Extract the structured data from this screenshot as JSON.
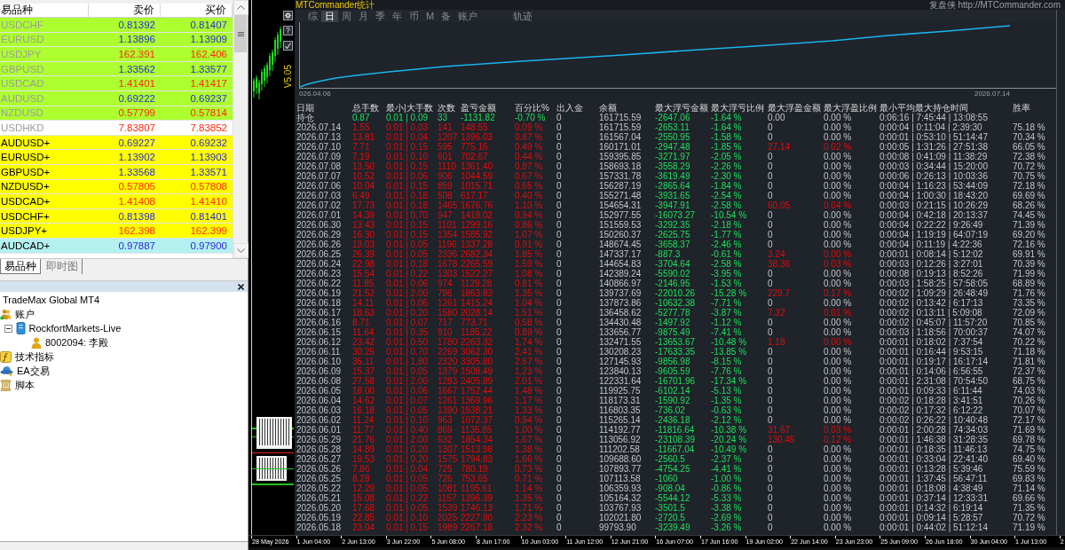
{
  "market_watch": {
    "columns": [
      "易品种",
      "卖价",
      "买价"
    ],
    "quotes": [
      {
        "symbol": "USDCHF",
        "bid": "0.81392",
        "ask": "0.81407",
        "rising": true,
        "color": "#adff2f",
        "greyed": true
      },
      {
        "symbol": "EURUSD",
        "bid": "1.13896",
        "ask": "1.13909",
        "rising": true,
        "color": "#adff2f",
        "greyed": true
      },
      {
        "symbol": "USDJPY",
        "bid": "162.391",
        "ask": "162.406",
        "rising": false,
        "color": "#adff2f",
        "greyed": true
      },
      {
        "symbol": "GBPUSD",
        "bid": "1.33562",
        "ask": "1.33577",
        "rising": true,
        "color": "#adff2f",
        "greyed": true
      },
      {
        "symbol": "USDCAD",
        "bid": "1.41401",
        "ask": "1.41417",
        "rising": false,
        "color": "#adff2f",
        "greyed": true
      },
      {
        "symbol": "AUDUSD",
        "bid": "0.69222",
        "ask": "0.69237",
        "rising": true,
        "color": "#adff2f",
        "greyed": true
      },
      {
        "symbol": "NZDUSD",
        "bid": "0.57799",
        "ask": "0.57814",
        "rising": false,
        "color": "#adff2f",
        "greyed": true
      },
      {
        "symbol": "USDHKD",
        "bid": "7.83807",
        "ask": "7.83852",
        "rising": false,
        "color": "#ffffff",
        "greyed": true
      },
      {
        "symbol": "AUDUSD+",
        "bid": "0.69227",
        "ask": "0.69232",
        "rising": true,
        "color": "#ffff00",
        "greyed": false
      },
      {
        "symbol": "EURUSD+",
        "bid": "1.13902",
        "ask": "1.13903",
        "rising": true,
        "color": "#ffff00",
        "greyed": false
      },
      {
        "symbol": "GBPUSD+",
        "bid": "1.33568",
        "ask": "1.33571",
        "rising": true,
        "color": "#ffff00",
        "greyed": false
      },
      {
        "symbol": "NZDUSD+",
        "bid": "0.57805",
        "ask": "0.57808",
        "rising": false,
        "color": "#ffff00",
        "greyed": false
      },
      {
        "symbol": "USDCAD+",
        "bid": "1.41408",
        "ask": "1.41410",
        "rising": false,
        "color": "#ffff00",
        "greyed": false
      },
      {
        "symbol": "USDCHF+",
        "bid": "0.81398",
        "ask": "0.81401",
        "rising": true,
        "color": "#ffff00",
        "greyed": false
      },
      {
        "symbol": "USDJPY+",
        "bid": "162.398",
        "ask": "162.399",
        "rising": false,
        "color": "#ffff00",
        "greyed": false
      },
      {
        "symbol": "AUDCAD+",
        "bid": "0.97887",
        "ask": "0.97900",
        "rising": true,
        "color": "#b4f0f0",
        "greyed": false
      }
    ]
  },
  "market_watch_tabs": [
    {
      "label": "易品种",
      "selected": true
    },
    {
      "label": "即时图",
      "selected": false
    }
  ],
  "navigator": {
    "tree": [
      {
        "label": "TradeMax Global MT4",
        "children": [
          {
            "label": "账户",
            "kind": "accounts",
            "children": [
              {
                "label": "RockfortMarkets-Live",
                "kind": "server",
                "expanded": true,
                "children": [
                  {
                    "label": "8002094: 李殿",
                    "kind": "account"
                  }
                ]
              }
            ]
          },
          {
            "label": "技术指标",
            "kind": "indicators"
          },
          {
            "label": "EA交易",
            "kind": "experts"
          },
          {
            "label": "脚本",
            "kind": "scripts"
          }
        ]
      }
    ]
  },
  "chart_window": {
    "version": "V5.05"
  },
  "stats_panel": {
    "title": "MTCommander统计",
    "link": "复盘侠 http://MTCommander.com",
    "tabs": [
      {
        "label": "综",
        "selected": false
      },
      {
        "label": "日",
        "selected": true
      },
      {
        "label": "周",
        "selected": false
      },
      {
        "label": "月",
        "selected": false
      },
      {
        "label": "季",
        "selected": false
      },
      {
        "label": "年",
        "selected": false
      },
      {
        "label": "币",
        "selected": false
      },
      {
        "label": "M",
        "selected": false
      },
      {
        "label": "备",
        "selected": false
      },
      {
        "label": "账户",
        "selected": false
      }
    ],
    "side_tabs": [
      {
        "label": "轨迹",
        "selected": false
      }
    ],
    "equity_chart": {
      "start_label": "026.04.06",
      "end_label": "2026.07.14"
    },
    "table": {
      "columns": [
        "日期",
        "总手数",
        "最小|大手数",
        "次数",
        "盈亏金额",
        "百分比%",
        "出入金",
        "余额",
        "最大浮亏金额",
        "最大浮亏比例",
        "最大浮盈金额",
        "最大浮盈比例",
        "最小平均最大持仓时间",
        "胜率"
      ],
      "rows": [
        {
          "kind": "holding",
          "floating_profit": false,
          "cells": [
            "持仓",
            "0.87",
            "0.01 | 0.09",
            "33",
            "-1131.82",
            "-0.70 %",
            "0",
            "161715.59",
            "-2647.06",
            "-1.64 %",
            "0.00",
            "0.00 %",
            "0:06:16 | 7:45:44 | 13:08:55"
          ]
        },
        {
          "kind": "day",
          "floating_profit": false,
          "cells": [
            "2026.07.14",
            "1.55",
            "0.01 | 0.03",
            "141",
            "148.55",
            "0.09 %",
            "0",
            "161715.59",
            "-2653.11",
            "-1.64 %",
            "0",
            "0.00 %",
            "0:00:04 | 0:11:04 | 2:39:30",
            "75.18 %"
          ]
        },
        {
          "kind": "day",
          "floating_profit": false,
          "cells": [
            "2026.07.13",
            "13.81",
            "0.01 | 0.04",
            "1207",
            "1396.03",
            "0.87 %",
            "0",
            "161567.04",
            "-2550.95",
            "-1.58 %",
            "0",
            "0.00 %",
            "0:00:01 | 0:53:10 | 51:14:47",
            "70.34 %"
          ]
        },
        {
          "kind": "day",
          "floating_profit": true,
          "cells": [
            "2026.07.10",
            "7.71",
            "0.01 | 0.15",
            "595",
            "775.16",
            "0.49 %",
            "0",
            "160171.01",
            "-2947.48",
            "-1.85 %",
            "27.14",
            "0.02 %",
            "0:00:05 | 1:31:26 | 27:51:38",
            "66.05 %"
          ]
        },
        {
          "kind": "day",
          "floating_profit": false,
          "cells": [
            "2026.07.09",
            "7.19",
            "0.01 | 0.10",
            "601",
            "702.67",
            "0.44 %",
            "0",
            "159395.85",
            "-3271.97",
            "-2.05 %",
            "0",
            "0.00 %",
            "0:00:08 | 0:41:09 | 11:38:29",
            "72.38 %"
          ]
        },
        {
          "kind": "day",
          "floating_profit": false,
          "cells": [
            "2026.07.08",
            "13.50",
            "0.01 | 0.15",
            "1110",
            "1361.40",
            "0.87 %",
            "0",
            "158693.18",
            "-3558.29",
            "-2.26 %",
            "0",
            "0.00 %",
            "0:00:03 | 0:34:44 | 15:20:00",
            "70.72 %"
          ]
        },
        {
          "kind": "day",
          "floating_profit": false,
          "cells": [
            "2026.07.07",
            "10.52",
            "0.01 | 0.06",
            "906",
            "1044.59",
            "0.67 %",
            "0",
            "157331.78",
            "-3619.49",
            "-2.30 %",
            "0",
            "0.00 %",
            "0:00:06 | 0:26:13 | 10:03:36",
            "70.75 %"
          ]
        },
        {
          "kind": "day",
          "floating_profit": false,
          "cells": [
            "2026.07.06",
            "10.04",
            "0.01 | 0.15",
            "859",
            "1015.71",
            "0.65 %",
            "0",
            "156287.19",
            "-2865.64",
            "-1.84 %",
            "0",
            "0.00 %",
            "0:00:04 | 1:16:23 | 53:44:09",
            "72.18 %"
          ]
        },
        {
          "kind": "day",
          "floating_profit": false,
          "cells": [
            "2026.07.03",
            "6.49",
            "0.01 | 0.18",
            "508",
            "617.17",
            "0.40 %",
            "0",
            "155271.48",
            "-3931.65",
            "-2.54 %",
            "0",
            "0.00 %",
            "0:00:04 | 1:00:30 | 18:43:20",
            "69.69 %"
          ]
        },
        {
          "kind": "day",
          "floating_profit": true,
          "cells": [
            "2026.07.02",
            "17.73",
            "0.01 | 0.18",
            "1465",
            "1676.76",
            "1.10 %",
            "0",
            "154654.31",
            "-3947.91",
            "-2.58 %",
            "60.05",
            "0.04 %",
            "0:00:03 | 0:21:15 | 10:26:29",
            "68.26 %"
          ]
        },
        {
          "kind": "day",
          "floating_profit": false,
          "cells": [
            "2026.07.01",
            "14.39",
            "0.01 | 0.70",
            "947",
            "1418.02",
            "0.94 %",
            "0",
            "152977.55",
            "-16073.27",
            "-10.54 %",
            "0",
            "0.00 %",
            "0:00:04 | 0:42:18 | 20:13:37",
            "74.45 %"
          ]
        },
        {
          "kind": "day",
          "floating_profit": false,
          "cells": [
            "2026.06.30",
            "13.43",
            "0.01 | 0.15",
            "1101",
            "1299.16",
            "0.86 %",
            "0",
            "151559.53",
            "-3292.35",
            "-2.18 %",
            "0",
            "0.00 %",
            "0:00:04 | 0:22:22 | 9:26:49",
            "71.39 %"
          ]
        },
        {
          "kind": "day",
          "floating_profit": false,
          "cells": [
            "2026.06.29",
            "16.30",
            "0.01 | 0.15",
            "1354",
            "1585.92",
            "1.07 %",
            "0",
            "150260.37",
            "-2625.75",
            "-1.77 %",
            "0",
            "0.00 %",
            "0:00:04 | 1:19:19 | 64:07:19",
            "69.20 %"
          ]
        },
        {
          "kind": "day",
          "floating_profit": false,
          "cells": [
            "2026.06.26",
            "13.03",
            "0.01 | 0.05",
            "1196",
            "1337.28",
            "0.91 %",
            "0",
            "148674.45",
            "-3658.37",
            "-2.46 %",
            "0",
            "0.00 %",
            "0:00:04 | 0:11:19 | 4:22:36",
            "72.16 %"
          ]
        },
        {
          "kind": "day",
          "floating_profit": true,
          "cells": [
            "2026.06.25",
            "26.39",
            "0.01 | 0.05",
            "2336",
            "2682.34",
            "1.85 %",
            "0",
            "147337.17",
            "-887.3",
            "-0.61 %",
            "3.24",
            "0.00 %",
            "0:00:01 | 0:08:14 | 5:12:02",
            "69.91 %"
          ]
        },
        {
          "kind": "day",
          "floating_profit": true,
          "cells": [
            "2026.06.24",
            "22.98",
            "0.01 | 0.18",
            "1678",
            "2265.59",
            "1.59 %",
            "0",
            "144654.83",
            "-3704.64",
            "-2.58 %",
            "38.36",
            "0.03 %",
            "0:00:03 | 0:12:26 | 3:27:01",
            "70.39 %"
          ]
        },
        {
          "kind": "day",
          "floating_profit": false,
          "cells": [
            "2026.06.23",
            "15.54",
            "0.01 | 0.22",
            "1303",
            "1522.27",
            "1.08 %",
            "0",
            "142389.24",
            "-5590.02",
            "-3.95 %",
            "0",
            "0.00 %",
            "0:00:08 | 0:19:13 | 8:52:26",
            "71.99 %"
          ]
        },
        {
          "kind": "day",
          "floating_profit": false,
          "cells": [
            "2026.06.22",
            "11.85",
            "0.01 | 0.06",
            "974",
            "1129.28",
            "0.81 %",
            "0",
            "140866.97",
            "-2146.95",
            "-1.53 %",
            "0",
            "0.00 %",
            "0:00:03 | 1:58:25 | 57:58:05",
            "68.89 %"
          ]
        },
        {
          "kind": "day",
          "floating_profit": true,
          "cells": [
            "2026.06.19",
            "21.52",
            "0.01 | 2.00",
            "786",
            "1863.83",
            "1.35 %",
            "0",
            "139737.69",
            "-22010.26",
            "-15.28 %",
            "229.7",
            "0.17 %",
            "0:00:02 | 1:09:29 | 26:48:49",
            "71.76 %"
          ]
        },
        {
          "kind": "day",
          "floating_profit": false,
          "cells": [
            "2026.06.18",
            "14.11",
            "0.01 | 0.06",
            "1261",
            "1415.24",
            "1.04 %",
            "0",
            "137873.86",
            "-10632.38",
            "-7.71 %",
            "0",
            "0.00 %",
            "0:00:02 | 0:13:42 | 6:17:13",
            "73.35 %"
          ]
        },
        {
          "kind": "day",
          "floating_profit": true,
          "cells": [
            "2026.06.17",
            "18.63",
            "0.01 | 0.20",
            "1580",
            "2028.14",
            "1.51 %",
            "0",
            "136458.62",
            "-5277.78",
            "-3.87 %",
            "7.32",
            "0.01 %",
            "0:00:02 | 0:13:11 | 5:09:08",
            "72.09 %"
          ]
        },
        {
          "kind": "day",
          "floating_profit": false,
          "cells": [
            "2026.06.16",
            "8.71",
            "0.01 | 0.07",
            "717",
            "773.71",
            "0.58 %",
            "0",
            "134430.48",
            "-1497.92",
            "-1.12 %",
            "0",
            "0.00 %",
            "0:00:02 | 0:45:07 | 11:57:20",
            "70.85 %"
          ]
        },
        {
          "kind": "day",
          "floating_profit": false,
          "cells": [
            "2026.06.15",
            "11.64",
            "0.01 | 0.35",
            "910",
            "1185.22",
            "0.89 %",
            "0",
            "133656.77",
            "-9875.49",
            "-7.41 %",
            "0",
            "0.00 %",
            "0:00:03 | 1:18:56 | 70:00:37",
            "74.07 %"
          ]
        },
        {
          "kind": "day",
          "floating_profit": true,
          "cells": [
            "2026.06.12",
            "23.42",
            "0.01 | 0.50",
            "1780",
            "2263.32",
            "1.74 %",
            "0",
            "132471.55",
            "-13653.67",
            "-10.48 %",
            "1.18",
            "0.00 %",
            "0:00:01 | 0:18:02 | 7:37:54",
            "70.22 %"
          ]
        },
        {
          "kind": "day",
          "floating_profit": false,
          "cells": [
            "2026.06.11",
            "30.25",
            "0.01 | 0.70",
            "2269",
            "3062.30",
            "2.41 %",
            "0",
            "130208.23",
            "-17633.35",
            "-13.85 %",
            "0",
            "0.00 %",
            "0:00:01 | 0:16:44 | 9:53:15",
            "71.18 %"
          ]
        },
        {
          "kind": "day",
          "floating_profit": false,
          "cells": [
            "2026.06.10",
            "35.11",
            "0.01 | 1.80",
            "2320",
            "3305.80",
            "2.67 %",
            "0",
            "127145.93",
            "-9856.98",
            "-8.15 %",
            "0",
            "0.00 %",
            "0:00:01 | 0:19:17 | 16:17:14",
            "71.81 %"
          ]
        },
        {
          "kind": "day",
          "floating_profit": false,
          "cells": [
            "2026.06.09",
            "15.37",
            "0.01 | 0.05",
            "1379",
            "1508.49",
            "1.23 %",
            "0",
            "123840.13",
            "-9605.59",
            "-7.76 %",
            "0",
            "0.00 %",
            "0:00:01 | 0:14:06 | 6:56:55",
            "72.37 %"
          ]
        },
        {
          "kind": "day",
          "floating_profit": false,
          "cells": [
            "2026.06.08",
            "27.58",
            "0.01 | 2.00",
            "1283",
            "2405.89",
            "2.01 %",
            "0",
            "122331.64",
            "-16701.96",
            "-17.34 %",
            "0",
            "0.00 %",
            "0:00:01 | 2:31:08 | 70:54:50",
            "68.75 %"
          ]
        },
        {
          "kind": "day",
          "floating_profit": false,
          "cells": [
            "2026.06.05",
            "18.00",
            "0.01 | 0.06",
            "1667",
            "1752.44",
            "1.48 %",
            "0",
            "119925.75",
            "-6102.14",
            "-5.13 %",
            "0",
            "0.00 %",
            "0:00:01 | 0:09:33 | 6:11:44",
            "74.03 %"
          ]
        },
        {
          "kind": "day",
          "floating_profit": false,
          "cells": [
            "2026.06.04",
            "14.62",
            "0.01 | 0.07",
            "1261",
            "1369.96",
            "1.17 %",
            "0",
            "118173.31",
            "-1590.92",
            "-1.35 %",
            "0",
            "0.00 %",
            "0:00:02 | 0:18:28 | 3:41:51",
            "70.26 %"
          ]
        },
        {
          "kind": "day",
          "floating_profit": false,
          "cells": [
            "2026.06.03",
            "16.18",
            "0.01 | 0.05",
            "1390",
            "1538.21",
            "1.33 %",
            "0",
            "116803.35",
            "-736.02",
            "-0.63 %",
            "0",
            "0.00 %",
            "0:00:02 | 0:17:32 | 6:12:22",
            "70.07 %"
          ]
        },
        {
          "kind": "day",
          "floating_profit": false,
          "cells": [
            "2026.06.02",
            "11.24",
            "0.01 | 0.10",
            "963",
            "1072.37",
            "0.94 %",
            "0",
            "115265.14",
            "-2436.18",
            "-2.12 %",
            "0",
            "0.00 %",
            "0:00:02 | 0:26:22 | 10:40:48",
            "72.17 %"
          ]
        },
        {
          "kind": "day",
          "floating_profit": true,
          "cells": [
            "2026.06.01",
            "11.77",
            "0.01 | 0.40",
            "869",
            "1135.85",
            "1.00 %",
            "0",
            "114192.77",
            "-11816.64",
            "-10.38 %",
            "31.67",
            "0.03 %",
            "0:00:01 | 2:00:28 | 74:34:03",
            "71.69 %"
          ]
        },
        {
          "kind": "day",
          "floating_profit": true,
          "cells": [
            "2026.05.29",
            "21.76",
            "0.01 | 2.00",
            "632",
            "1854.34",
            "1.67 %",
            "0",
            "113056.92",
            "-23108.39",
            "-20.24 %",
            "130.45",
            "0.12 %",
            "0:00:01 | 1:46:38 | 31:28:35",
            "69.78 %"
          ]
        },
        {
          "kind": "day",
          "floating_profit": false,
          "cells": [
            "2026.05.28",
            "14.89",
            "0.01 | 0.20",
            "1307",
            "1513.98",
            "1.38 %",
            "0",
            "111202.58",
            "-11667.04",
            "-10.49 %",
            "0",
            "0.00 %",
            "0:00:01 | 0:18:35 | 11:46:13",
            "74.75 %"
          ]
        },
        {
          "kind": "day",
          "floating_profit": false,
          "cells": [
            "2026.05.27",
            "19.53",
            "0.01 | 0.20",
            "1575",
            "1794.83",
            "1.66 %",
            "0",
            "109688.60",
            "-2560.5",
            "-2.37 %",
            "0",
            "0.00 %",
            "0:00:01 | 0:33:04 | 22:41:40",
            "69.40 %"
          ]
        },
        {
          "kind": "day",
          "floating_profit": false,
          "cells": [
            "2026.05.26",
            "7.86",
            "0.01 | 0.04",
            "725",
            "780.19",
            "0.73 %",
            "0",
            "107893.77",
            "-4754.25",
            "-4.41 %",
            "0",
            "0.00 %",
            "0:00:01 | 0:13:28 | 5:39:46",
            "75.59 %"
          ]
        },
        {
          "kind": "day",
          "floating_profit": false,
          "cells": [
            "2026.05.25",
            "8.28",
            "0.01 | 0.05",
            "726",
            "753.65",
            "0.71 %",
            "0",
            "107113.58",
            "-1060",
            "-1.00 %",
            "0",
            "0.00 %",
            "0:00:01 | 1:37:45 | 56:47:11",
            "69.83 %"
          ]
        },
        {
          "kind": "day",
          "floating_profit": false,
          "cells": [
            "2026.05.22",
            "12.29",
            "0.01 | 0.05",
            "1081",
            "1195.61",
            "1.14 %",
            "0",
            "106359.93",
            "-908.04",
            "-0.86 %",
            "0",
            "0.00 %",
            "0:00:01 | 0:18:08 | 4:38:49",
            "71.14 %"
          ]
        },
        {
          "kind": "day",
          "floating_profit": false,
          "cells": [
            "2026.05.21",
            "15.08",
            "0.01 | 0.22",
            "1157",
            "1396.39",
            "1.35 %",
            "0",
            "105164.32",
            "-5544.12",
            "-5.33 %",
            "0",
            "0.00 %",
            "0:00:01 | 0:37:14 | 12:33:31",
            "69.66 %"
          ]
        },
        {
          "kind": "day",
          "floating_profit": false,
          "cells": [
            "2026.05.20",
            "17.68",
            "0.01 | 0.05",
            "1539",
            "1746.13",
            "1.71 %",
            "0",
            "103767.93",
            "-3501.5",
            "-3.38 %",
            "0",
            "0.00 %",
            "0:00:01 | 0:14:32 | 6:19:14",
            "71.35 %"
          ]
        },
        {
          "kind": "day",
          "floating_profit": false,
          "cells": [
            "2026.05.19",
            "22.85",
            "0.01 | 0.10",
            "2025",
            "2227.90",
            "2.23 %",
            "0",
            "102021.80",
            "-2720.5",
            "-2.69 %",
            "0",
            "0.00 %",
            "0:00:01 | 0:09:14 | 5:28:57",
            "70.72 %"
          ]
        },
        {
          "kind": "day",
          "floating_profit": false,
          "cells": [
            "2026.05.18",
            "23.04",
            "0.01 | 0.15",
            "1989",
            "2267.18",
            "2.32 %",
            "0",
            "99793.90",
            "-3239.49",
            "-3.26 %",
            "0",
            "0.00 %",
            "0:00:01 | 0:44:02 | 51:12:14",
            "71.19 %"
          ]
        }
      ]
    }
  },
  "time_axis": [
    "28 May 2026",
    "1 Jun 04:00",
    "2 Jun 13:00",
    "3 Jun 22:00",
    "5 Jun 08:00",
    "8 Jun 17:00",
    "10 Jun 03:00",
    "11 Jun 12:00",
    "12 Jun 21:00",
    "16 Jun 07:00",
    "17 Jun 16:00",
    "19 Jun 02:00",
    "22 Jun 14:00",
    "23 Jun 23:00",
    "25 Jun 09:00",
    "26 Jun 18:00",
    "30 Jun 04:00",
    "1 Jul 13:00",
    "2"
  ]
}
